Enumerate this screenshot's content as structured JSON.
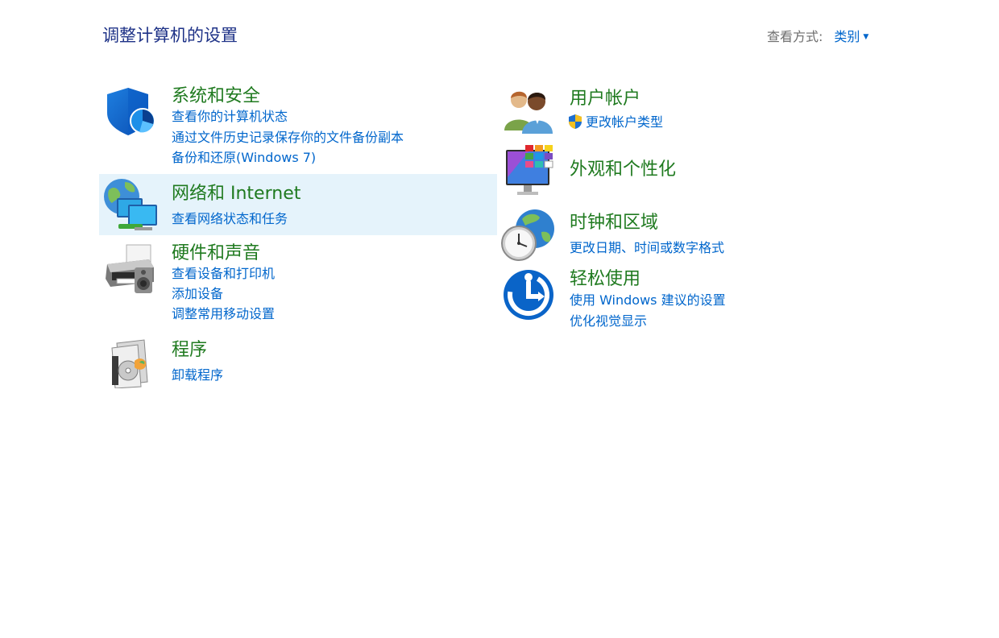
{
  "header": {
    "title": "调整计算机的设置",
    "view_by_label": "查看方式:",
    "view_by_value": "类别"
  },
  "categories": {
    "system": {
      "title": "系统和安全",
      "links": [
        "查看你的计算机状态",
        "通过文件历史记录保存你的文件备份副本",
        "备份和还原(Windows 7)"
      ]
    },
    "network": {
      "title": "网络和 Internet",
      "links": [
        "查看网络状态和任务"
      ]
    },
    "hardware": {
      "title": "硬件和声音",
      "links": [
        "查看设备和打印机",
        "添加设备",
        "调整常用移动设置"
      ]
    },
    "programs": {
      "title": "程序",
      "links": [
        "卸载程序"
      ]
    },
    "user_accounts": {
      "title": "用户帐户",
      "links": [
        "更改帐户类型"
      ]
    },
    "appearance": {
      "title": "外观和个性化",
      "links": []
    },
    "clock": {
      "title": "时钟和区域",
      "links": [
        "更改日期、时间或数字格式"
      ]
    },
    "ease": {
      "title": "轻松使用",
      "links": [
        "使用 Windows 建议的设置",
        "优化视觉显示"
      ]
    }
  },
  "colors": {
    "title_green": "#1f7a1f",
    "link_blue": "#0066cc",
    "page_title": "#1e3287",
    "hover_bg": "#e5f3fb"
  }
}
